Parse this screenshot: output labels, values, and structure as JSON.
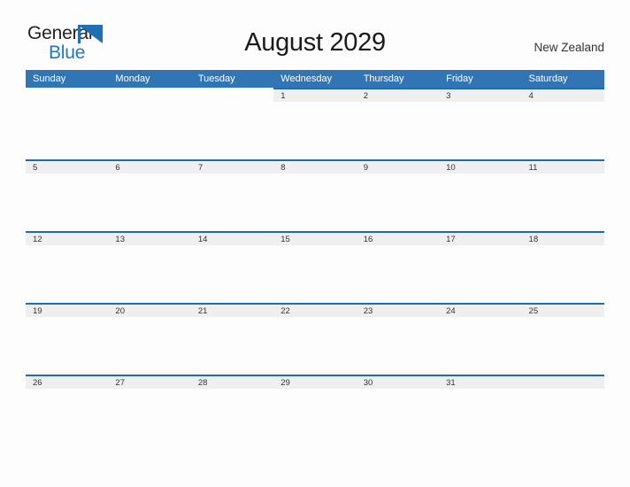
{
  "logo": {
    "word1": "General",
    "word2": "Blue",
    "triangle_color": "#1f6fb2",
    "word1_color": "#231f20",
    "word2_color": "#1c7ac9",
    "icon": "triangle-flag-icon"
  },
  "header": {
    "title": "August 2029",
    "region": "New Zealand"
  },
  "theme": {
    "header_blue": "#3175b4",
    "accent_line_blue": "#1f6bb0",
    "daynum_band_gray": "#efefef",
    "page_background": "#fdfdfd",
    "text_dark": "#333333"
  },
  "calendar": {
    "month": "August",
    "year": "2029",
    "weekday_headers": [
      "Sunday",
      "Monday",
      "Tuesday",
      "Wednesday",
      "Thursday",
      "Friday",
      "Saturday"
    ],
    "weeks": [
      [
        {
          "day": "",
          "filled": false
        },
        {
          "day": "",
          "filled": false
        },
        {
          "day": "",
          "filled": false
        },
        {
          "day": "1",
          "filled": true
        },
        {
          "day": "2",
          "filled": true
        },
        {
          "day": "3",
          "filled": true
        },
        {
          "day": "4",
          "filled": true
        }
      ],
      [
        {
          "day": "5",
          "filled": true
        },
        {
          "day": "6",
          "filled": true
        },
        {
          "day": "7",
          "filled": true
        },
        {
          "day": "8",
          "filled": true
        },
        {
          "day": "9",
          "filled": true
        },
        {
          "day": "10",
          "filled": true
        },
        {
          "day": "11",
          "filled": true
        }
      ],
      [
        {
          "day": "12",
          "filled": true
        },
        {
          "day": "13",
          "filled": true
        },
        {
          "day": "14",
          "filled": true
        },
        {
          "day": "15",
          "filled": true
        },
        {
          "day": "16",
          "filled": true
        },
        {
          "day": "17",
          "filled": true
        },
        {
          "day": "18",
          "filled": true
        }
      ],
      [
        {
          "day": "19",
          "filled": true
        },
        {
          "day": "20",
          "filled": true
        },
        {
          "day": "21",
          "filled": true
        },
        {
          "day": "22",
          "filled": true
        },
        {
          "day": "23",
          "filled": true
        },
        {
          "day": "24",
          "filled": true
        },
        {
          "day": "25",
          "filled": true
        }
      ],
      [
        {
          "day": "26",
          "filled": true
        },
        {
          "day": "27",
          "filled": true
        },
        {
          "day": "28",
          "filled": true
        },
        {
          "day": "29",
          "filled": true
        },
        {
          "day": "30",
          "filled": true
        },
        {
          "day": "31",
          "filled": true
        },
        {
          "day": "",
          "filled": true
        }
      ]
    ]
  }
}
